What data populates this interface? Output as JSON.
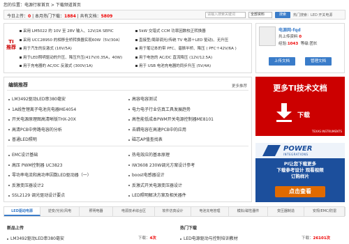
{
  "breadcrumb": "您的位置：电源行家首页 > 下载频道首页",
  "stats": {
    "today_label": "今日上传：",
    "today_value": "0",
    "month_label": " | 本月热门下载：",
    "month_value": "1884",
    "total_label": " | 共有文档：",
    "total_value": "5809"
  },
  "search": {
    "placeholder": "请输入搜索关键词",
    "category": "全部资料",
    "button": "搜索",
    "hot_words": "热门搜索：LED 开关电源"
  },
  "ti_section": {
    "logo": "TI推荐",
    "left_items": [
      "采用 LM5022 的 10V 至 28V 输入、12V/2A SEPIC",
      "采用 UCC28950 的相移全桥转换器实现60W（5V/30A）",
      "用于汽车的反激式 (16V/5A)",
      "用于LED照明驱动的升压、降压升压(417V/0.35A，40W)",
      "用于充电器的 AC/DC 反激式 (300V/1A)"
    ],
    "right_items": [
      "5kW 交错式 CCM 功率因数校正转换器",
      "直接型/周部调光(传统 TV 电源＋LED 驱动)、无升压",
      "用于笔记本的带 PFC、谐振半桥、降压 ( PFC＋42V/6A )",
      "用于电信的 AC/DC 直流降压 (12V/12.5A)",
      "用于 USB 电池充电器的同步升压 (5V/4A)"
    ]
  },
  "user": {
    "name": "电源网-fqd",
    "shared_label": "共上传资料",
    "shared_value": "0",
    "exp_label": "经验:",
    "exp_value": "1043",
    "rank_label": "等级:",
    "rank_value": "团长",
    "upload_btn": "上传文档",
    "manage_btn": "管理文档"
  },
  "recommend": {
    "title": "编辑推荐",
    "more": "更多推荐",
    "left_top": [
      "LM3492驱动LED串380毫安",
      "1A线性锂离子电池充电器ME4054",
      "开关电源原理图高清晰版THX-20X",
      "高清PCB中旁路电容的分析",
      "普通LED照明"
    ],
    "right_top": [
      "高容电容测试",
      "电力电子行业仿真工具发展趋势",
      "高性能低成本PWM开关电源控制器ME8101",
      "去耦电容在高速PCB中的应用",
      "磁芯AP值查找表"
    ],
    "left_bottom": [
      "EMC设计基础",
      "高压 PWM控制器 UC3823",
      "零功率电流和高功率因数LED驱动器（一）",
      "反激变压器设计2",
      "SSL2129 调光驱动设计要点"
    ],
    "right_bottom": [
      "热电效应的基本原理",
      "IW3608 230W调光方案设计参考",
      "boost电感器设计",
      "反激式开关电源变压器设计",
      "LED照明解决方案及相关器件"
    ]
  },
  "ad_ti": {
    "title": "更多TI技术文档",
    "download": "下载",
    "brand": "TEXAS INSTRUMENTS"
  },
  "ad_pi": {
    "brand": "POWER",
    "brand_sub": "INTEGRATIONS",
    "line1": "PI让您下载更多",
    "line2": "下载参考设计 观看视频",
    "line3": "订购样片",
    "cta": "点击查看"
  },
  "tabs": [
    "LED驱动电源",
    "逆变/光伏/风电",
    "照明电器",
    "电源技术综合区",
    "软件仿真设计",
    "电池充电管理",
    "模拟/磁性器件",
    "变压器制造",
    "安规/EMC/防雷"
  ],
  "bottom": {
    "new_title": "新品上传",
    "hot_title": "热门下载",
    "new_item": "LM3492驱动LED串380毫安",
    "new_meta_label": "下载：",
    "new_meta_value": "4次",
    "hot_item": "LED电源驱动与控制培训教材",
    "hot_meta_label": "下载：",
    "hot_meta_value": "26101次"
  },
  "colors": {
    "accent": "#3a7cc9",
    "red": "#e00000",
    "ti_red": "#cc0000",
    "pi_blue": "#1c4f9c"
  }
}
